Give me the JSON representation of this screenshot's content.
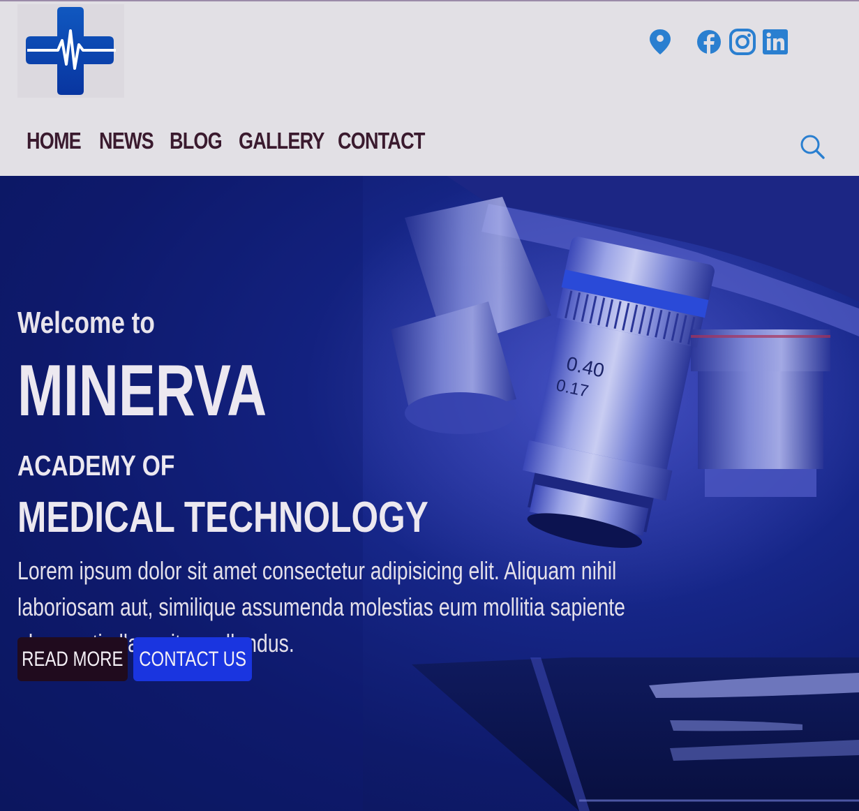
{
  "header": {
    "logo": {
      "icon": "medical-cross-heartbeat-icon",
      "color": "#0a3ea8"
    },
    "social_icons": [
      "location-pin-icon",
      "facebook-icon",
      "instagram-icon",
      "linkedin-icon"
    ],
    "icon_color": "#2a7fd0",
    "search_icon": "search-icon"
  },
  "nav": {
    "items": [
      {
        "label": "HOME"
      },
      {
        "label": "NEWS"
      },
      {
        "label": "BLOG"
      },
      {
        "label": "GALLERY"
      },
      {
        "label": "CONTACT"
      }
    ]
  },
  "hero": {
    "welcome": "Welcome to",
    "brand": "MINERVA",
    "line1": "ACADEMY OF",
    "line2": "MEDICAL TECHNOLOGY",
    "body": "Lorem ipsum dolor sit amet consectetur adipisicing elit. Aliquam nihil laboriosam aut, similique assumenda molestias eum mollitia sapiente obcaecati ullam sit repellendus.",
    "read_more": "READ MORE",
    "contact_us": "CONTACT US",
    "background_image": "microscope-objective-lenses",
    "lens_label_1": "0.40",
    "lens_label_2": "0.17"
  },
  "colors": {
    "nav_text": "#3a1a2e",
    "hero_bg": "#162688",
    "read_more_bg": "#200b1e",
    "contact_bg": "#1a35e0"
  }
}
